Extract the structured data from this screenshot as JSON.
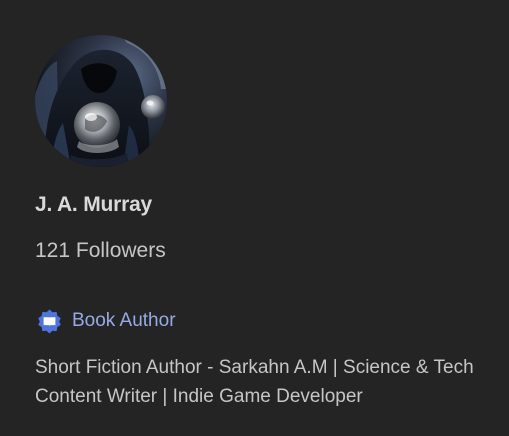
{
  "profile": {
    "avatar_icon": "hooded-figure-crystal-ball-avatar",
    "name": "J. A. Murray",
    "followers": "121 Followers",
    "badge": {
      "icon": "book-badge-icon",
      "label": "Book Author",
      "color": "#96abe6",
      "icon_color": "#4f74de"
    },
    "bio": "Short Fiction Author - Sarkahn A.M | Science & Tech Content Writer | Indie Game Developer"
  },
  "theme": {
    "background": "#242424",
    "text_primary": "#d9d9d9",
    "text_secondary": "#c6c6c6"
  }
}
